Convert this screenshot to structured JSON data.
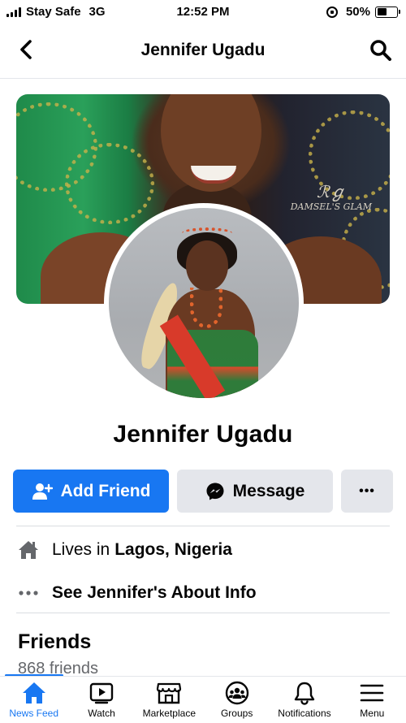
{
  "status_bar": {
    "carrier": "Stay Safe",
    "network": "3G",
    "time": "12:52 PM",
    "battery_percent_label": "50%",
    "battery_level": 0.5
  },
  "nav": {
    "title": "Jennifer Ugadu",
    "back_icon": "chevron-left-icon",
    "search_icon": "search-icon"
  },
  "cover": {
    "watermark": "DAMSEL'S GLAM"
  },
  "profile": {
    "name": "Jennifer Ugadu"
  },
  "actions": {
    "add_friend_label": "Add Friend",
    "message_label": "Message",
    "more_label": "•••"
  },
  "info": {
    "lives_prefix": "Lives in",
    "lives_location": "Lagos, Nigeria",
    "about_label": "See Jennifer's About Info"
  },
  "friends": {
    "heading": "Friends",
    "count_label": "868 friends"
  },
  "tabs": [
    {
      "label": "News Feed",
      "icon": "home-icon",
      "active": true
    },
    {
      "label": "Watch",
      "icon": "watch-icon",
      "active": false
    },
    {
      "label": "Marketplace",
      "icon": "marketplace-icon",
      "active": false
    },
    {
      "label": "Groups",
      "icon": "groups-icon",
      "active": false
    },
    {
      "label": "Notifications",
      "icon": "bell-icon",
      "active": false
    },
    {
      "label": "Menu",
      "icon": "menu-icon",
      "active": false
    }
  ],
  "colors": {
    "accent": "#1877f2",
    "secondary_button": "#e4e6eb",
    "text": "#050505",
    "muted_text": "#65676b"
  }
}
